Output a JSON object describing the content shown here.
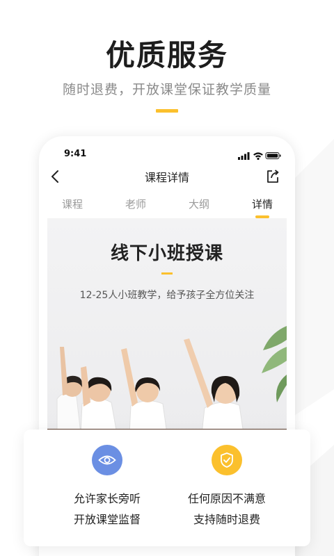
{
  "hero": {
    "title": "优质服务",
    "subtitle": "随时退费，开放课堂保证教学质量"
  },
  "phone": {
    "status_time": "9:41",
    "nav_title": "课程详情",
    "tabs": [
      {
        "label": "课程"
      },
      {
        "label": "老师"
      },
      {
        "label": "大纲"
      },
      {
        "label": "详情"
      }
    ],
    "content": {
      "title": "线下小班授课",
      "subtitle": "12-25人小班教学，给予孩子全方位关注"
    }
  },
  "features": [
    {
      "icon": "eye-icon",
      "color": "#6b8fe3",
      "line1": "允许家长旁听",
      "line2": "开放课堂监督"
    },
    {
      "icon": "shield-check-icon",
      "color": "#fbc02d",
      "line1": "任何原因不满意",
      "line2": "支持随时退费"
    }
  ],
  "colors": {
    "accent": "#fbc02d",
    "blue": "#6b8fe3"
  }
}
